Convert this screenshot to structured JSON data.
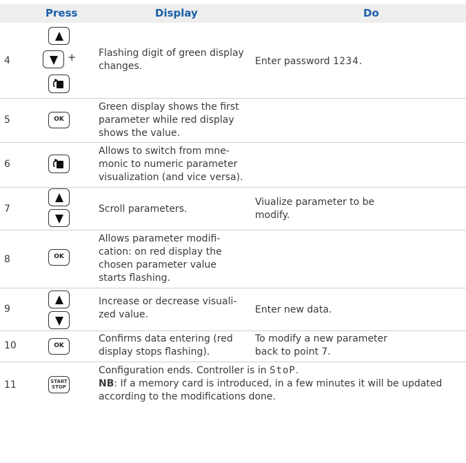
{
  "headers": {
    "press": "Press",
    "display": "Display",
    "do": "Do"
  },
  "rows": [
    {
      "num": "4",
      "display": "Flashing digit of green display changes.",
      "do_prefix": "Enter password",
      "do_code": "1234",
      "do_suffix": ".",
      "keys": [
        "up-arrow",
        "down-arrow",
        "set"
      ]
    },
    {
      "num": "5",
      "display": "Green display shows the first parameter while red display shows the value.",
      "do": "",
      "keys": [
        "ok"
      ]
    },
    {
      "num": "6",
      "display": "Allows to switch from mne-monic to numeric parameter visualization (and vice versa).",
      "do": "",
      "keys": [
        "set"
      ]
    },
    {
      "num": "7",
      "display": "Scroll parameters.",
      "do": "Viualize parameter to be modify.",
      "keys": [
        "up-arrow",
        "down-arrow"
      ]
    },
    {
      "num": "8",
      "display": "Allows parameter modifi-cation: on red display the chosen parameter value starts flashing.",
      "do": "",
      "keys": [
        "ok"
      ]
    },
    {
      "num": "9",
      "display": "Increase or decrease visuali-zed value.",
      "do": "Enter new data.",
      "keys": [
        "up-arrow",
        "down-arrow"
      ]
    },
    {
      "num": "10",
      "display": "Confirms data entering (red display stops flashing).",
      "do": "To modify a new parameter back to point 7.",
      "keys": [
        "ok"
      ]
    },
    {
      "num": "11",
      "display_prefix": "Configuration ends. Controller is in",
      "display_code": "StoP",
      "display_suffix": ".",
      "nb_label": "NB",
      "nb_text": ": If a memory card is introduced, in a few minutes it will be updated according to the modifications done.",
      "keys": [
        "start-stop"
      ]
    }
  ],
  "key_labels": {
    "ok": "OK",
    "plus": "+",
    "start": "START",
    "stop": "STOP"
  }
}
